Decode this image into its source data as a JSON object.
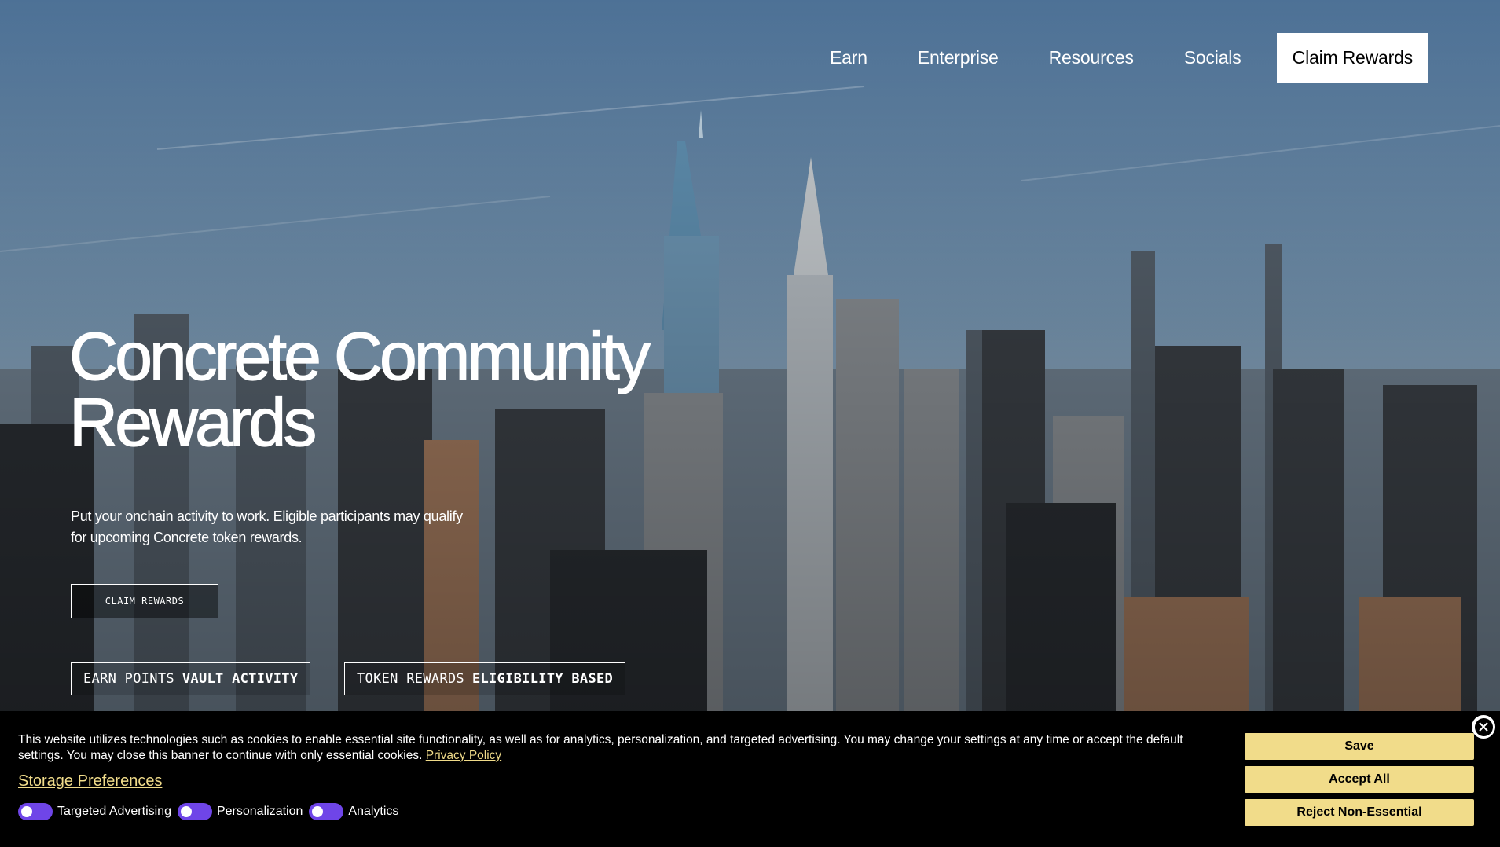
{
  "nav": {
    "items": [
      "Earn",
      "Enterprise",
      "Resources",
      "Socials"
    ],
    "cta_label": "Claim Rewards"
  },
  "hero": {
    "title_line1": "Concrete Community",
    "title_line2": "Rewards",
    "subtitle_line1": "Put your onchain activity to work. Eligible participants may qualify",
    "subtitle_line2": "for upcoming Concrete token rewards.",
    "cta_label": "CLAIM REWARDS",
    "pills": [
      {
        "label": "EARN POINTS",
        "strong": "VAULT ACTIVITY"
      },
      {
        "label": "TOKEN REWARDS",
        "strong": "ELIGIBILITY BASED"
      }
    ]
  },
  "cookie_banner": {
    "text": "This website utilizes technologies such as cookies to enable essential site functionality, as well as for analytics, personalization, and targeted advertising. You may change your settings at any time or accept the default settings. You may close this banner to continue with only essential cookies.",
    "privacy_link": "Privacy Policy",
    "storage_link": "Storage Preferences",
    "toggles": [
      "Targeted Advertising",
      "Personalization",
      "Analytics"
    ],
    "buttons": {
      "save": "Save",
      "accept": "Accept All",
      "reject": "Reject Non-Essential"
    },
    "colors": {
      "accent": "#f1dc8a",
      "toggle": "#6f45e8"
    }
  }
}
